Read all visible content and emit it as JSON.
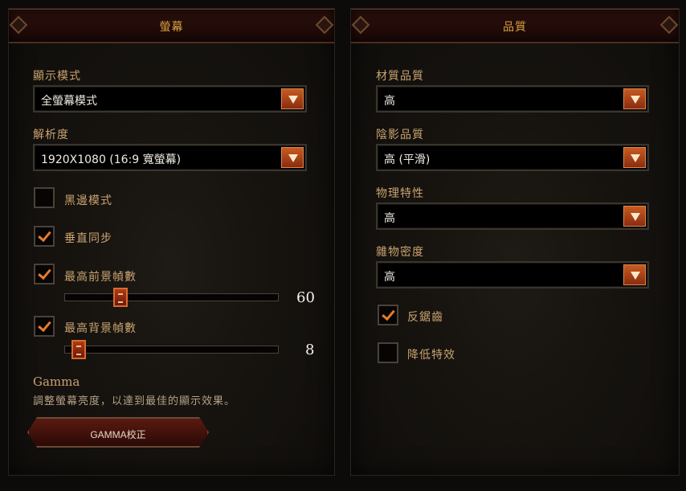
{
  "display": {
    "header": "螢幕",
    "display_mode_label": "顯示模式",
    "display_mode_value": "全螢幕模式",
    "resolution_label": "解析度",
    "resolution_value": "1920X1080 (16:9 寬螢幕)",
    "letterbox_label": "黑邊模式",
    "letterbox_checked": false,
    "vsync_label": "垂直同步",
    "vsync_checked": true,
    "max_fg_fps_label": "最高前景幀數",
    "max_fg_fps_checked": true,
    "max_fg_fps_value": "60",
    "max_bg_fps_label": "最高背景幀數",
    "max_bg_fps_checked": true,
    "max_bg_fps_value": "8",
    "gamma_title": "Gamma",
    "gamma_desc": "調整螢幕亮度，以達到最佳的顯示效果。",
    "gamma_button": "GAMMA校正"
  },
  "quality": {
    "header": "品質",
    "texture_label": "材質品質",
    "texture_value": "高",
    "shadow_label": "陰影品質",
    "shadow_value": "高 (平滑)",
    "physics_label": "物理特性",
    "physics_value": "高",
    "clutter_label": "雜物密度",
    "clutter_value": "高",
    "antialias_label": "反鋸齒",
    "antialias_checked": true,
    "low_fx_label": "降低特效",
    "low_fx_checked": false
  },
  "colors": {
    "accent": "#e87a30",
    "label": "#c9a370",
    "header_text": "#d8a040"
  }
}
